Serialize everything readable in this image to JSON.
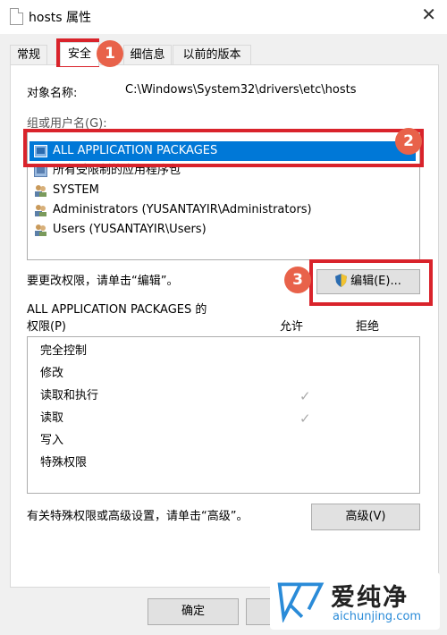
{
  "window": {
    "title": "hosts 属性",
    "close_symbol": "✕"
  },
  "tabs": [
    {
      "label": "常规"
    },
    {
      "label": "安全"
    },
    {
      "label": "细信息"
    },
    {
      "label": "以前的版本"
    }
  ],
  "object": {
    "label": "对象名称:",
    "value": "C:\\Windows\\System32\\drivers\\etc\\hosts"
  },
  "groups": {
    "label": "组或用户名(G):",
    "items": [
      {
        "name": "ALL APPLICATION PACKAGES",
        "icon": "app-package-icon",
        "selected": true
      },
      {
        "name": "所有受限制的应用程序包",
        "icon": "app-package-icon"
      },
      {
        "name": "SYSTEM",
        "icon": "users-icon"
      },
      {
        "name": "Administrators (YUSANTAYIR\\Administrators)",
        "icon": "users-icon"
      },
      {
        "name": "Users (YUSANTAYIR\\Users)",
        "icon": "users-icon"
      }
    ]
  },
  "edit": {
    "hint": "要更改权限，请单击“编辑”。",
    "button": "编辑(E)..."
  },
  "permissions": {
    "title_line1": "ALL APPLICATION PACKAGES 的",
    "title_line2": "权限(P)",
    "allow": "允许",
    "deny": "拒绝",
    "rows": [
      {
        "name": "完全控制",
        "allow": false
      },
      {
        "name": "修改",
        "allow": false
      },
      {
        "name": "读取和执行",
        "allow": true
      },
      {
        "name": "读取",
        "allow": true
      },
      {
        "name": "写入",
        "allow": false
      },
      {
        "name": "特殊权限",
        "allow": false
      }
    ],
    "check_symbol": "✓"
  },
  "advanced": {
    "hint": "有关特殊权限或高级设置，请单击“高级”。",
    "button": "高级(V)"
  },
  "footer": {
    "ok": "确定"
  },
  "annotations": [
    "1",
    "2",
    "3"
  ],
  "watermark": {
    "name": "爱纯净",
    "url": "aichunjing.com"
  },
  "colors": {
    "selection": "#0078d7",
    "annotation": "#d9232b",
    "badge": "#e8624a"
  }
}
